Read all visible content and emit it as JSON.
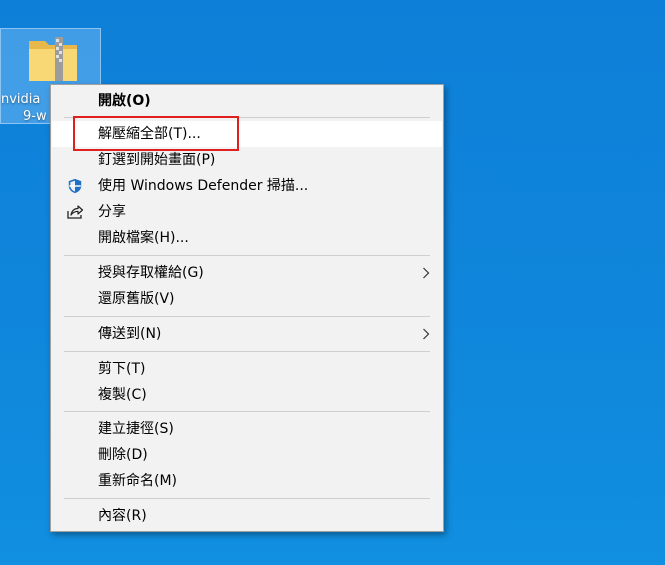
{
  "desktop": {
    "icon_label_line1": "nvidia",
    "icon_label_line2": "9-w"
  },
  "context_menu": {
    "items": [
      {
        "label": "開啟(O)",
        "bold": true
      },
      {
        "label": "解壓縮全部(T)..."
      },
      {
        "label": "釘選到開始畫面(P)"
      },
      {
        "label": "使用 Windows Defender 掃描...",
        "icon": "windows-defender-shield-icon"
      },
      {
        "label": "分享",
        "icon": "share-icon"
      },
      {
        "label": "開啟檔案(H)..."
      },
      {
        "label": "授與存取權給(G)",
        "submenu": true
      },
      {
        "label": "還原舊版(V)"
      },
      {
        "label": "傳送到(N)",
        "submenu": true
      },
      {
        "label": "剪下(T)"
      },
      {
        "label": "複製(C)"
      },
      {
        "label": "建立捷徑(S)"
      },
      {
        "label": "刪除(D)"
      },
      {
        "label": "重新命名(M)"
      },
      {
        "label": "內容(R)"
      }
    ]
  },
  "colors": {
    "desktop_background": "#0f86db",
    "menu_background": "#f2f2f2",
    "highlight_border": "#e0201e",
    "defender_blue": "#1f6fc5"
  }
}
